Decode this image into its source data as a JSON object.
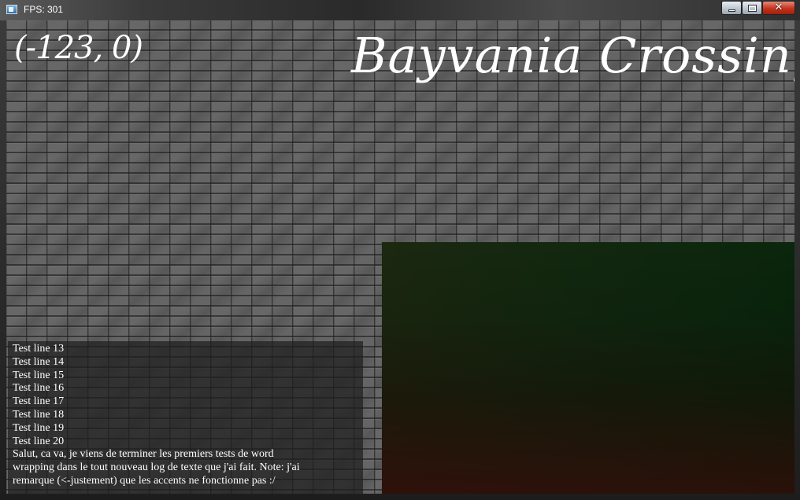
{
  "window": {
    "title": "FPS: 301",
    "controls": {
      "minimize": "minimize",
      "maximize": "maximize",
      "close": "✕"
    }
  },
  "hud": {
    "coordinates": "(-123, 0)",
    "logo_text": "Bayvania Crossing"
  },
  "console": {
    "lines": [
      "Test line 13",
      "Test line 14",
      "Test line 15",
      "Test line 16",
      "Test line 17",
      "Test line 18",
      "Test line 19",
      "Test line 20",
      "Salut, ca va, je viens de terminer les premiers tests de word",
      "wrapping dans le tout nouveau log de texte que j'ai fait. Note: j'ai",
      "remarque (<-justement) que les accents ne fonctionne pas :/"
    ]
  },
  "colors": {
    "text": "#ffffff",
    "console_bg": "#1e1e1e",
    "minimap_top": "#0a260c",
    "minimap_bottom": "#3a0a05"
  }
}
